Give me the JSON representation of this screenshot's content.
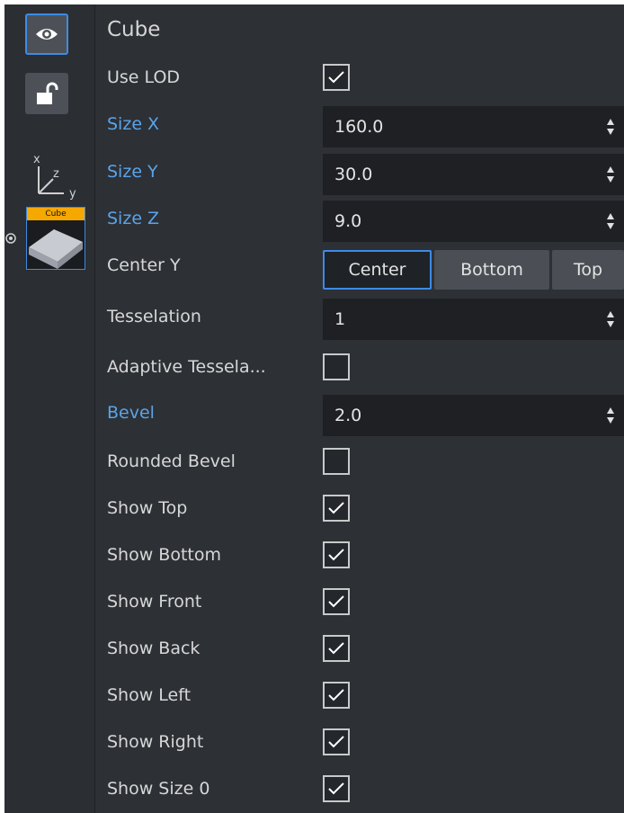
{
  "sidebar": {
    "visibility_icon": "eye-icon",
    "lock_icon": "unlocked-padlock-icon",
    "axis_icon": "xyz-axes-icon",
    "axis_labels": {
      "x": "x",
      "y": "y",
      "z": "z"
    },
    "thumbnail_label": "Cube"
  },
  "panel": {
    "title": "Cube",
    "accent_color": "#3d8be4",
    "blue_label_color": "#5aa4ea"
  },
  "properties": {
    "use_lod": {
      "label": "Use LOD",
      "checked": true
    },
    "size_x": {
      "label": "Size X",
      "value": "160.0"
    },
    "size_y": {
      "label": "Size Y",
      "value": "30.0"
    },
    "size_z": {
      "label": "Size Z",
      "value": "9.0"
    },
    "center_y": {
      "label": "Center Y",
      "options": [
        "Center",
        "Bottom",
        "Top"
      ],
      "selected": "Center"
    },
    "tesselation": {
      "label": "Tesselation",
      "value": "1"
    },
    "adaptive_tesselation": {
      "label": "Adaptive Tessela...",
      "checked": false
    },
    "bevel": {
      "label": "Bevel",
      "value": "2.0"
    },
    "rounded_bevel": {
      "label": "Rounded Bevel",
      "checked": false
    },
    "show_top": {
      "label": "Show Top",
      "checked": true
    },
    "show_bottom": {
      "label": "Show Bottom",
      "checked": true
    },
    "show_front": {
      "label": "Show Front",
      "checked": true
    },
    "show_back": {
      "label": "Show Back",
      "checked": true
    },
    "show_left": {
      "label": "Show Left",
      "checked": true
    },
    "show_right": {
      "label": "Show Right",
      "checked": true
    },
    "show_size_0": {
      "label": "Show Size 0",
      "checked": true
    }
  }
}
